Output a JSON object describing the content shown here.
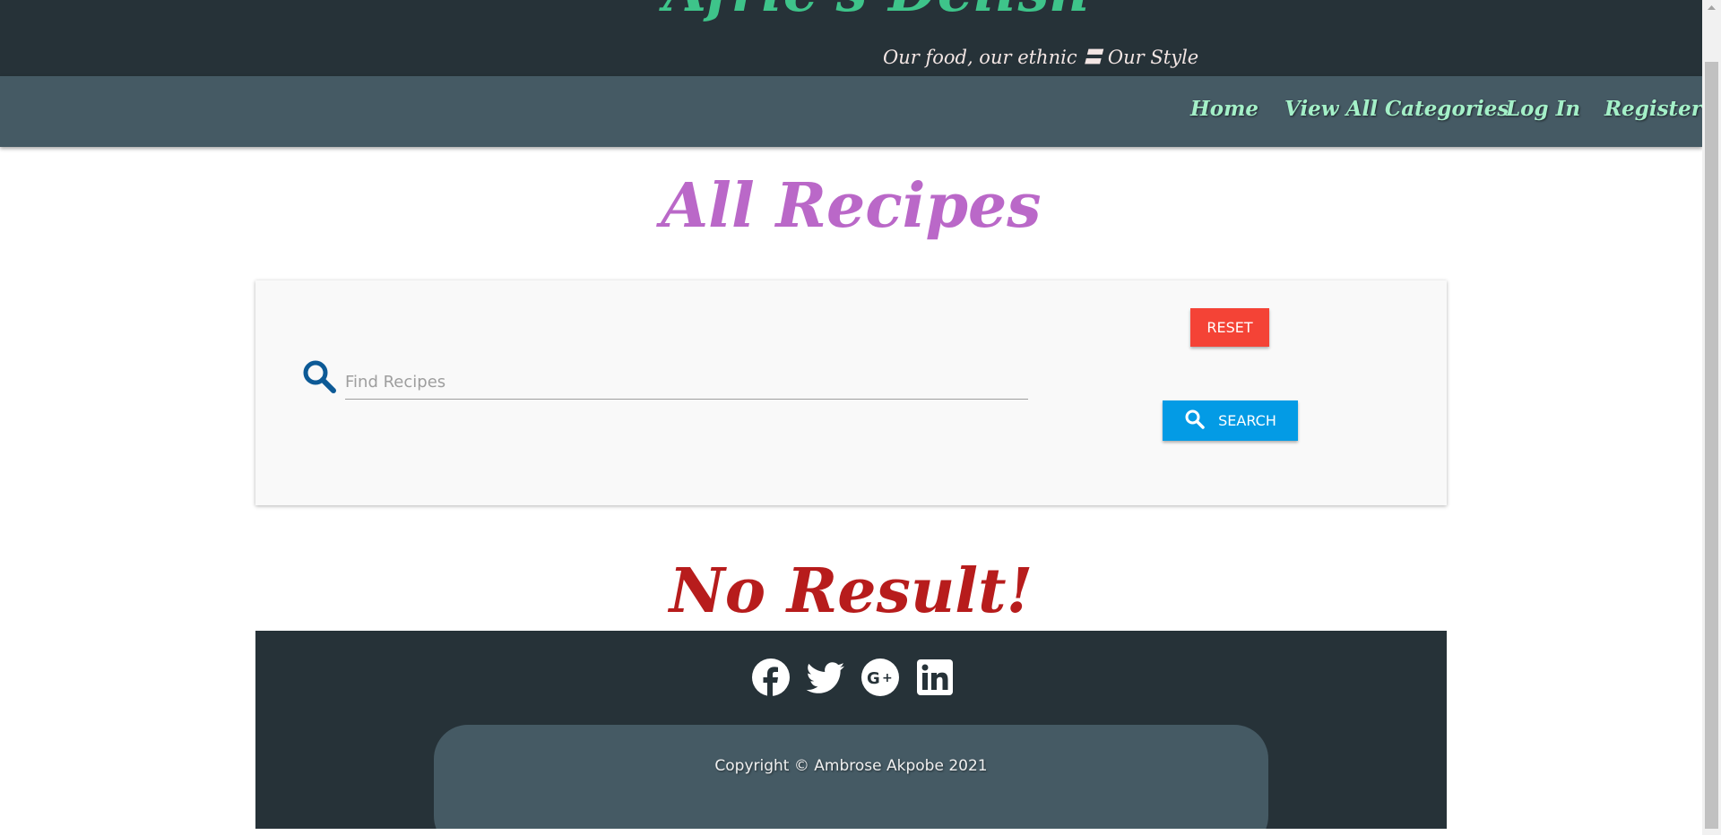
{
  "header": {
    "brand_title": "Afric's Delish",
    "tagline": "Our food, our ethnic 〓 Our Style"
  },
  "nav": {
    "items": [
      {
        "label": "Home"
      },
      {
        "label": "View All Categories"
      },
      {
        "label": "Log In"
      },
      {
        "label": "Register"
      }
    ]
  },
  "main": {
    "title": "All Recipes",
    "search": {
      "placeholder": "Find Recipes",
      "value": "",
      "icon": "search-icon",
      "reset_label": "RESET",
      "search_label": "SEARCH"
    },
    "no_result": "No Result!"
  },
  "footer": {
    "social_icons": [
      "facebook-icon",
      "twitter-icon",
      "google-plus-icon",
      "linkedin-icon"
    ],
    "copyright": "Copyright © Ambrose Akpobe 2021"
  },
  "colors": {
    "header_bg": "#263238",
    "nav_bg": "#455a64",
    "brand": "#3ec48a",
    "nav_link": "#a4f0c8",
    "title": "#ba68c8",
    "no_result": "#b71c1c",
    "reset_button": "#f44336",
    "search_button": "#039be5",
    "search_icon": "#0d5a96"
  }
}
